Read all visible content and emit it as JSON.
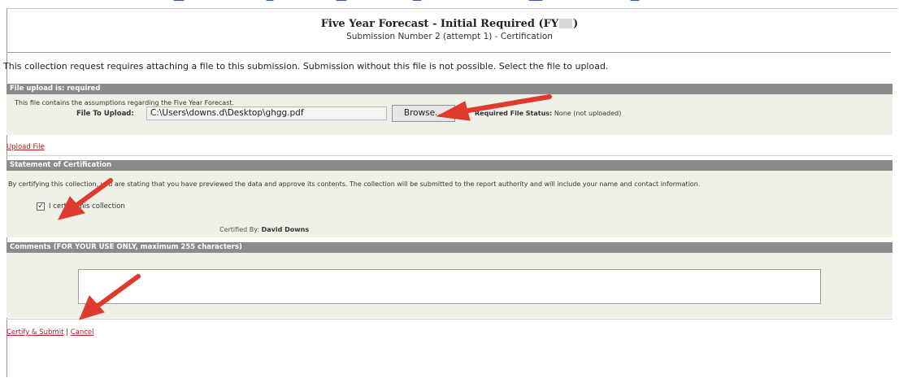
{
  "header": {
    "title_prefix": "Five Year Forecast - Initial Required (FY",
    "title_suffix": ")",
    "subtitle": "Submission Number 2 (attempt 1) - Certification"
  },
  "intro_text": "This collection request requires attaching a file to this submission. Submission without this file is not possible. Select the file to upload.",
  "file_upload": {
    "section_title": "File upload is: required",
    "description": "This file contains the assumptions regarding the Five Year Forecast.",
    "file_label": "File To Upload:",
    "file_value": "C:\\Users\\downs.d\\Desktop\\ghgg.pdf",
    "browse_label": "Browse...",
    "status_label": "Required File Status:",
    "status_value": "None (not uploaded)",
    "upload_link": "Upload File"
  },
  "certification": {
    "section_title": "Statement of Certification",
    "statement": "By certifying this collection, you are stating that you have previewed the data and approve its contents. The collection will be submitted to the report authority and will include your name and contact information.",
    "checkbox_label": "I certify this collection",
    "checked": true,
    "certified_by_label": "Certified By:",
    "certified_by_value": "David Downs"
  },
  "comments": {
    "section_title": "Comments (FOR YOUR USE ONLY, maximum 255 characters)",
    "value": ""
  },
  "actions": {
    "submit_label": "Certify & Submit",
    "separator": "|",
    "cancel_label": "Cancel"
  },
  "colors": {
    "section_bar": "#8b8b8b",
    "section_body": "#eff0e6",
    "link": "#b22222",
    "annotation_arrow": "#e03a2f"
  }
}
